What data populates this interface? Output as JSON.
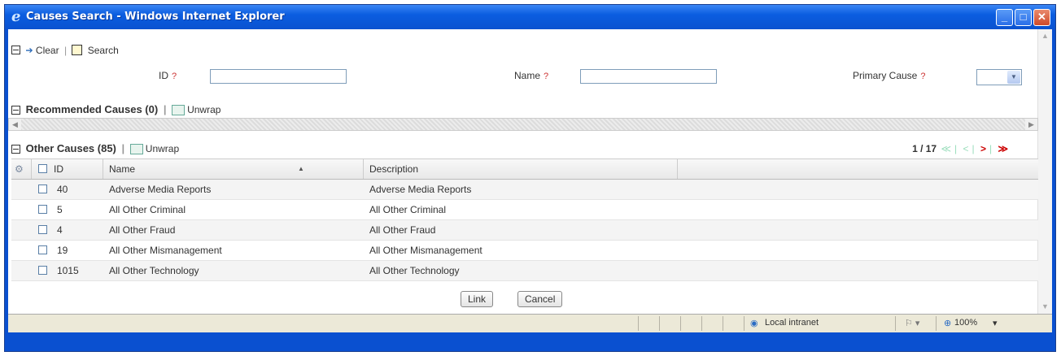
{
  "window": {
    "title": "Causes Search - Windows Internet Explorer"
  },
  "toolbar": {
    "clear": "Clear",
    "sep": "|",
    "search": "Search"
  },
  "filters": {
    "id_label": "ID",
    "name_label": "Name",
    "primary_cause_label": "Primary Cause",
    "help": "?",
    "id_value": "",
    "name_value": "",
    "primary_cause_value": ""
  },
  "recommended": {
    "title": "Recommended Causes (0)",
    "sep": "|",
    "unwrap": "Unwrap"
  },
  "other": {
    "title": "Other Causes (85)",
    "sep": "|",
    "unwrap": "Unwrap"
  },
  "pager": {
    "page": "1 / 17",
    "first": "≪",
    "prev": "<",
    "next": ">",
    "last": "≫",
    "sep": "|"
  },
  "grid": {
    "headers": {
      "id": "ID",
      "name": "Name",
      "description": "Description",
      "sort_indicator": "▲"
    },
    "rows": [
      {
        "id": "40",
        "name": "Adverse Media Reports",
        "description": "Adverse Media Reports"
      },
      {
        "id": "5",
        "name": "All Other Criminal",
        "description": "All Other Criminal"
      },
      {
        "id": "4",
        "name": "All Other Fraud",
        "description": "All Other Fraud"
      },
      {
        "id": "19",
        "name": "All Other Mismanagement",
        "description": "All Other Mismanagement"
      },
      {
        "id": "1015",
        "name": "All Other Technology",
        "description": "All Other Technology"
      }
    ]
  },
  "buttons": {
    "link": "Link",
    "cancel": "Cancel"
  },
  "status": {
    "zone": "Local intranet",
    "zoom": "100%"
  }
}
